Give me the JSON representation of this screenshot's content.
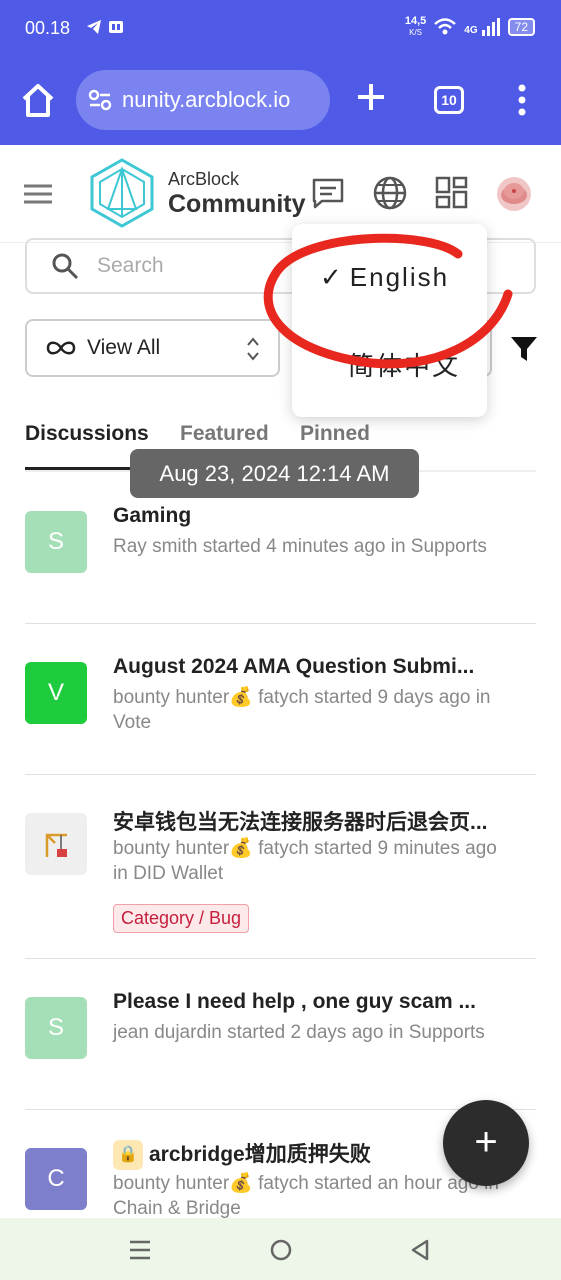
{
  "status_bar": {
    "time": "00.18",
    "net_speed_value": "14,5",
    "net_speed_unit": "K/S",
    "signal": "4G",
    "battery": "72"
  },
  "browser": {
    "url": "nunity.arcblock.io",
    "tab_count": "10"
  },
  "header": {
    "brand_top": "ArcBlock",
    "brand_bottom": "Community"
  },
  "search": {
    "placeholder": "Search"
  },
  "filter": {
    "view_label": "View All"
  },
  "tabs": [
    {
      "label": "Discussions"
    },
    {
      "label": "Featured"
    },
    {
      "label": "Pinned"
    }
  ],
  "tooltip": "Aug 23, 2024 12:14 AM",
  "language_menu": {
    "check": "✓",
    "items": [
      {
        "label": "English",
        "selected": true
      },
      {
        "label": "简体中文",
        "selected": false
      }
    ]
  },
  "discussions": [
    {
      "avatar_letter": "S",
      "avatar_color": "#a5dfb7",
      "title": "Gaming",
      "meta": "Ray smith started 4 minutes ago in Supports"
    },
    {
      "avatar_letter": "V",
      "avatar_color": "#1ecb3c",
      "title": "August 2024 AMA Question Submi...",
      "meta": "bounty hunter💰 fatych started 9 days ago in Vote"
    },
    {
      "avatar_letter": "",
      "avatar_color": "#efefef",
      "title": "安卓钱包当无法连接服务器时后退会页...",
      "meta": "bounty hunter💰 fatych started 9 minutes ago in DID Wallet",
      "category": "Category / Bug"
    },
    {
      "avatar_letter": "S",
      "avatar_color": "#a5dfb7",
      "title": "Please I need help , one guy scam ...",
      "meta": "jean dujardin started 2 days ago in Supports"
    },
    {
      "avatar_letter": "C",
      "avatar_color": "#7e7fcb",
      "title": "arcbridge增加质押失败",
      "lock_icon": "lock-icon",
      "meta": "bounty hunter💰 fatych started an hour ago in Chain & Bridge"
    }
  ],
  "fab_label": "+",
  "colors": {
    "browser_bar": "#4f5be7",
    "accent_red": "#e8281e",
    "category_red": "#c4203c"
  }
}
